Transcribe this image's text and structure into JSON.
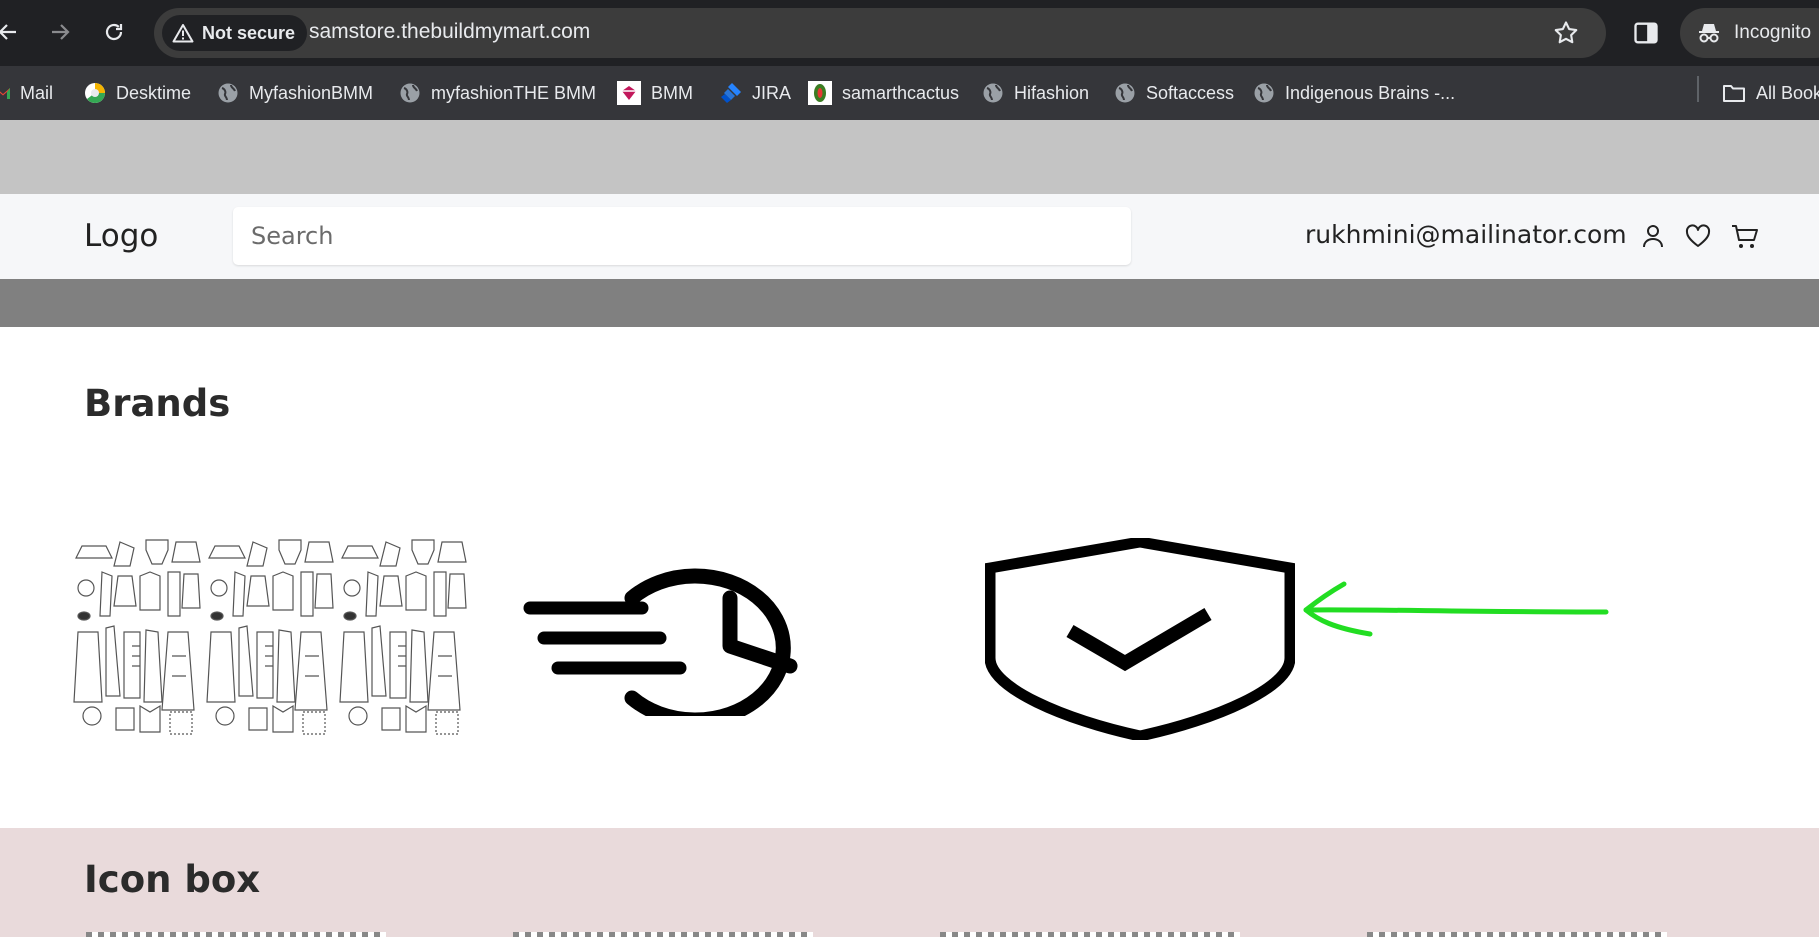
{
  "browser": {
    "security_label": "Not secure",
    "url": "samstore.thebuildmymart.com",
    "profile_label": "Incognito",
    "bookmarks": [
      {
        "label": "Mail",
        "icon": "gmail-icon"
      },
      {
        "label": "Desktime",
        "icon": "desktime-icon"
      },
      {
        "label": "MyfashionBMM",
        "icon": "globe-icon"
      },
      {
        "label": "myfashionTHE BMM",
        "icon": "globe-icon"
      },
      {
        "label": "BMM",
        "icon": "bmm-icon"
      },
      {
        "label": "JIRA",
        "icon": "jira-icon"
      },
      {
        "label": "samarthcactus",
        "icon": "cactus-icon"
      },
      {
        "label": "Hifashion",
        "icon": "globe-icon"
      },
      {
        "label": "Softaccess",
        "icon": "globe-icon"
      },
      {
        "label": "Indigenous Brains -...",
        "icon": "globe-icon"
      }
    ],
    "all_bookmarks_label": "All Book"
  },
  "header": {
    "logo": "Logo",
    "search_placeholder": "Search",
    "user_email": "rukhmini@mailinator.com"
  },
  "brands": {
    "title": "Brands",
    "items": [
      {
        "icon": "fashion-pattern-image"
      },
      {
        "icon": "fast-clock-icon"
      },
      {
        "icon": "shield-check-icon"
      }
    ],
    "annotation": "green-arrow-annotation"
  },
  "icon_box": {
    "title": "Icon box"
  },
  "colors": {
    "chrome_dark": "#202124",
    "omnibox": "#3c3c3c",
    "bookmarks_bar": "#35363a",
    "gray_band": "#c4c4c4",
    "header_bg": "#f6f7f9",
    "dark_band": "#808080",
    "icon_box_bg": "#e9dadb",
    "annotation_green": "#22dd22"
  }
}
